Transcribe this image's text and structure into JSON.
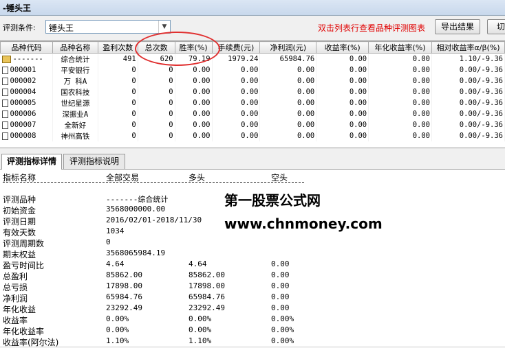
{
  "window": {
    "title": "-锤头王"
  },
  "toolbar": {
    "condition_label": "评测条件:",
    "condition_value": "锤头王",
    "hint": "双击列表行查看品种评测图表",
    "export_label": "导出结果",
    "switch_label": "切"
  },
  "grid": {
    "headers": [
      "品种代码",
      "品种名称",
      "盈利次数",
      "总次数",
      "胜率(%)",
      "手续费(元)",
      "净利润(元)",
      "收益率(%)",
      "年化收益率(%)",
      "相对收益率α/β(%)"
    ],
    "rows": [
      [
        "-------",
        "综合统计",
        "491",
        "620",
        "79.19",
        "1979.24",
        "65984.76",
        "0.00",
        "0.00",
        "1.10/-9.36"
      ],
      [
        "000001",
        "平安银行",
        "0",
        "0",
        "0.00",
        "0.00",
        "0.00",
        "0.00",
        "0.00",
        "0.00/-9.36"
      ],
      [
        "000002",
        "万 科A",
        "0",
        "0",
        "0.00",
        "0.00",
        "0.00",
        "0.00",
        "0.00",
        "0.00/-9.36"
      ],
      [
        "000004",
        "国农科技",
        "0",
        "0",
        "0.00",
        "0.00",
        "0.00",
        "0.00",
        "0.00",
        "0.00/-9.36"
      ],
      [
        "000005",
        "世纪星源",
        "0",
        "0",
        "0.00",
        "0.00",
        "0.00",
        "0.00",
        "0.00",
        "0.00/-9.36"
      ],
      [
        "000006",
        "深振业A",
        "0",
        "0",
        "0.00",
        "0.00",
        "0.00",
        "0.00",
        "0.00",
        "0.00/-9.36"
      ],
      [
        "000007",
        "全新好",
        "0",
        "0",
        "0.00",
        "0.00",
        "0.00",
        "0.00",
        "0.00",
        "0.00/-9.36"
      ],
      [
        "000008",
        "神州高铁",
        "0",
        "0",
        "0.00",
        "0.00",
        "0.00",
        "0.00",
        "0.00",
        "0.00/-9.36"
      ]
    ]
  },
  "tabs": [
    {
      "label": "评测指标详情"
    },
    {
      "label": "评测指标说明"
    }
  ],
  "detail": {
    "col_headers": {
      "name": "指标名称",
      "all": "全部交易",
      "long": "多头",
      "short": "空头"
    },
    "rows": [
      [
        "评测品种",
        "-------综合统计",
        "",
        ""
      ],
      [
        "初始资金",
        "3568000000.00",
        "",
        ""
      ],
      [
        "评测日期",
        "2016/02/01-2018/11/30",
        "",
        ""
      ],
      [
        "有效天数",
        "1034",
        "",
        ""
      ],
      [
        "评测周期数",
        "0",
        "",
        ""
      ],
      [
        "期末权益",
        "3568065984.19",
        "",
        ""
      ],
      [
        "盈亏时间比",
        "4.64",
        "4.64",
        "0.00"
      ],
      [
        "总盈利",
        "85862.00",
        "85862.00",
        "0.00"
      ],
      [
        "总亏损",
        "17898.00",
        "17898.00",
        "0.00"
      ],
      [
        "净利润",
        "65984.76",
        "65984.76",
        "0.00"
      ],
      [
        "年化收益",
        "23292.49",
        "23292.49",
        "0.00"
      ],
      [
        "收益率",
        "0.00%",
        "0.00%",
        "0.00%"
      ],
      [
        "年化收益率",
        "0.00%",
        "0.00%",
        "0.00%"
      ],
      [
        "收益率(阿尔法)",
        "1.10%",
        "1.10%",
        "0.00%"
      ]
    ]
  },
  "watermark": {
    "line1": "第一股票公式网",
    "line2": "www.chnmoney.com"
  },
  "colors": {
    "hint": "#e00000",
    "circle": "#e03030"
  }
}
